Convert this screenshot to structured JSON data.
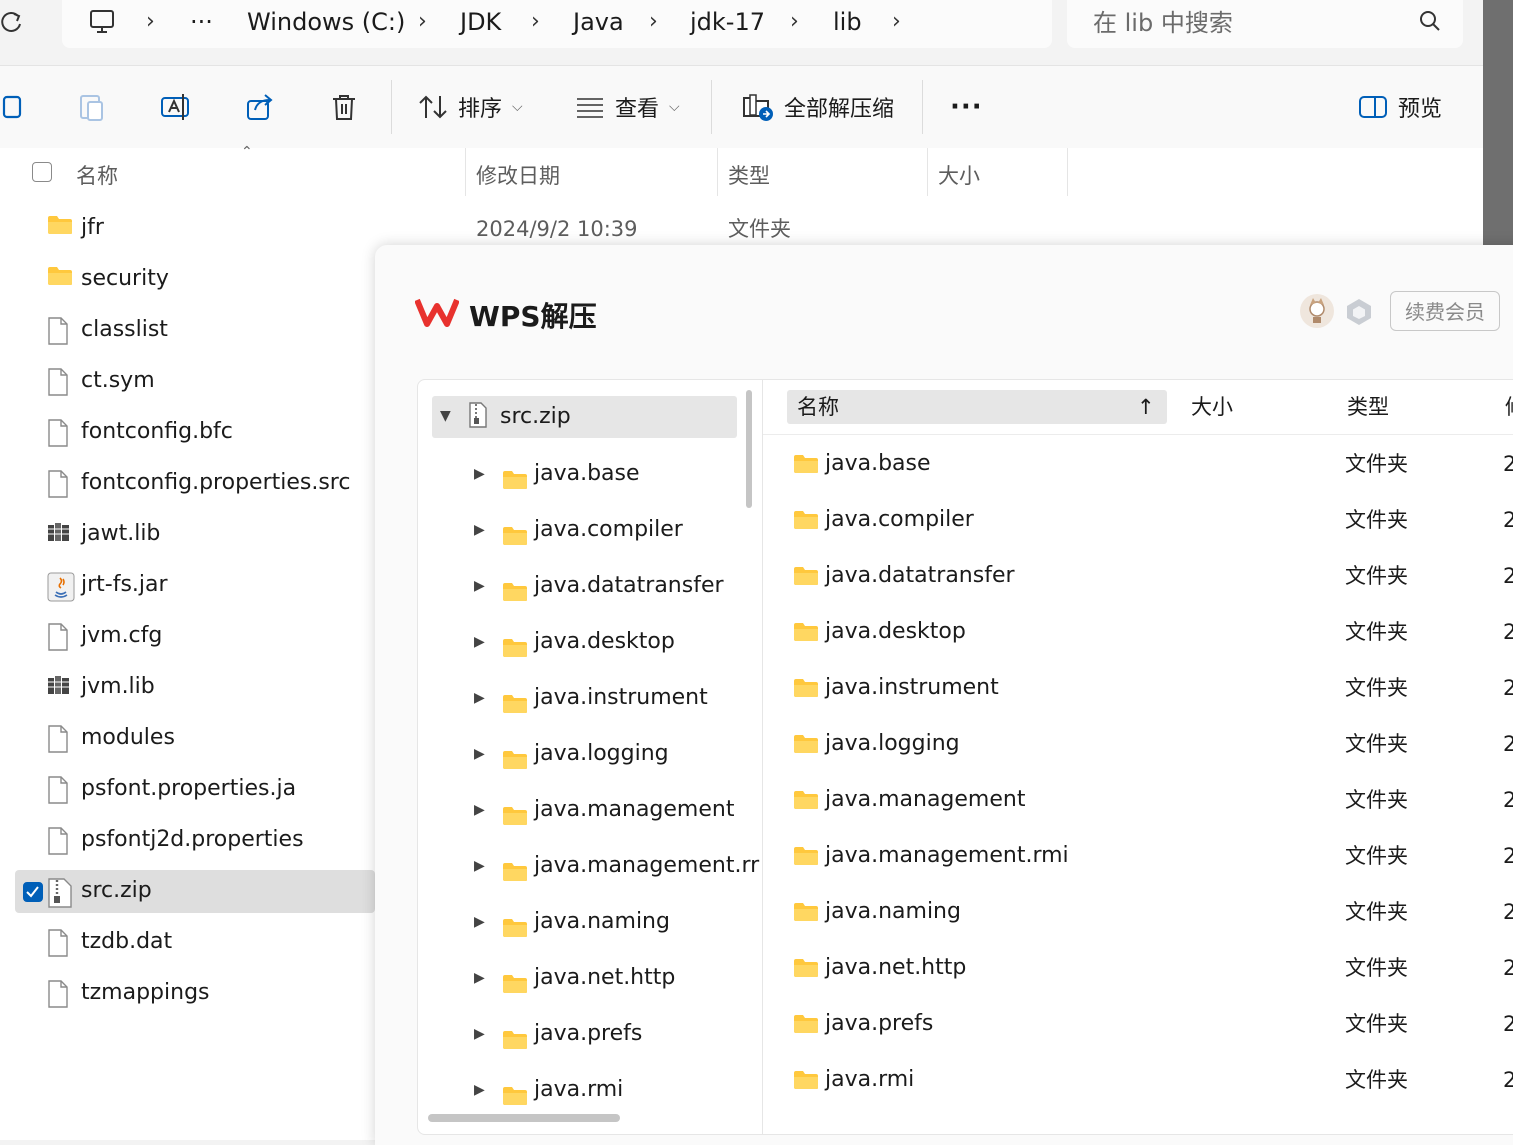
{
  "addressbar": {
    "more_label": "···",
    "crumbs": [
      "Windows (C:)",
      "JDK",
      "Java",
      "jdk-17",
      "lib"
    ],
    "search_placeholder": "在 lib 中搜索"
  },
  "toolbar": {
    "sort_label": "排序",
    "view_label": "查看",
    "extract_all_label": "全部解压缩",
    "more_label": "···",
    "preview_label": "预览"
  },
  "filelist": {
    "headers": {
      "name": "名称",
      "modified": "修改日期",
      "type": "类型",
      "size": "大小"
    },
    "first_row_date": "2024/9/2 10:39",
    "first_row_type": "文件夹",
    "items": [
      {
        "name": "jfr",
        "icon": "folder-icon"
      },
      {
        "name": "security",
        "icon": "folder-icon"
      },
      {
        "name": "classlist",
        "icon": "file-icon"
      },
      {
        "name": "ct.sym",
        "icon": "file-icon"
      },
      {
        "name": "fontconfig.bfc",
        "icon": "file-icon"
      },
      {
        "name": "fontconfig.properties.src",
        "icon": "file-icon"
      },
      {
        "name": "jawt.lib",
        "icon": "library-icon"
      },
      {
        "name": "jrt-fs.jar",
        "icon": "jar-icon"
      },
      {
        "name": "jvm.cfg",
        "icon": "file-icon"
      },
      {
        "name": "jvm.lib",
        "icon": "library-icon"
      },
      {
        "name": "modules",
        "icon": "file-icon"
      },
      {
        "name": "psfont.properties.ja",
        "icon": "file-icon"
      },
      {
        "name": "psfontj2d.properties",
        "icon": "file-icon"
      },
      {
        "name": "src.zip",
        "icon": "zip-icon",
        "selected": true
      },
      {
        "name": "tzdb.dat",
        "icon": "file-icon"
      },
      {
        "name": "tzmappings",
        "icon": "file-icon"
      }
    ]
  },
  "wps": {
    "title": "WPS解压",
    "renew_label": "续费会员",
    "accent_color": "#e8322e",
    "tree": {
      "root": "src.zip",
      "children": [
        "java.base",
        "java.compiler",
        "java.datatransfer",
        "java.desktop",
        "java.instrument",
        "java.logging",
        "java.management",
        "java.management.rr",
        "java.naming",
        "java.net.http",
        "java.prefs",
        "java.rmi"
      ]
    },
    "list": {
      "headers": {
        "name": "名称",
        "size": "大小",
        "type": "类型",
        "date": "修"
      },
      "rows": [
        {
          "name": "java.base",
          "type": "文件夹",
          "date": "2"
        },
        {
          "name": "java.compiler",
          "type": "文件夹",
          "date": "2"
        },
        {
          "name": "java.datatransfer",
          "type": "文件夹",
          "date": "2"
        },
        {
          "name": "java.desktop",
          "type": "文件夹",
          "date": "2"
        },
        {
          "name": "java.instrument",
          "type": "文件夹",
          "date": "2"
        },
        {
          "name": "java.logging",
          "type": "文件夹",
          "date": "2"
        },
        {
          "name": "java.management",
          "type": "文件夹",
          "date": "2"
        },
        {
          "name": "java.management.rmi",
          "type": "文件夹",
          "date": "2"
        },
        {
          "name": "java.naming",
          "type": "文件夹",
          "date": "2"
        },
        {
          "name": "java.net.http",
          "type": "文件夹",
          "date": "2"
        },
        {
          "name": "java.prefs",
          "type": "文件夹",
          "date": "2"
        },
        {
          "name": "java.rmi",
          "type": "文件夹",
          "date": "2"
        }
      ]
    }
  }
}
